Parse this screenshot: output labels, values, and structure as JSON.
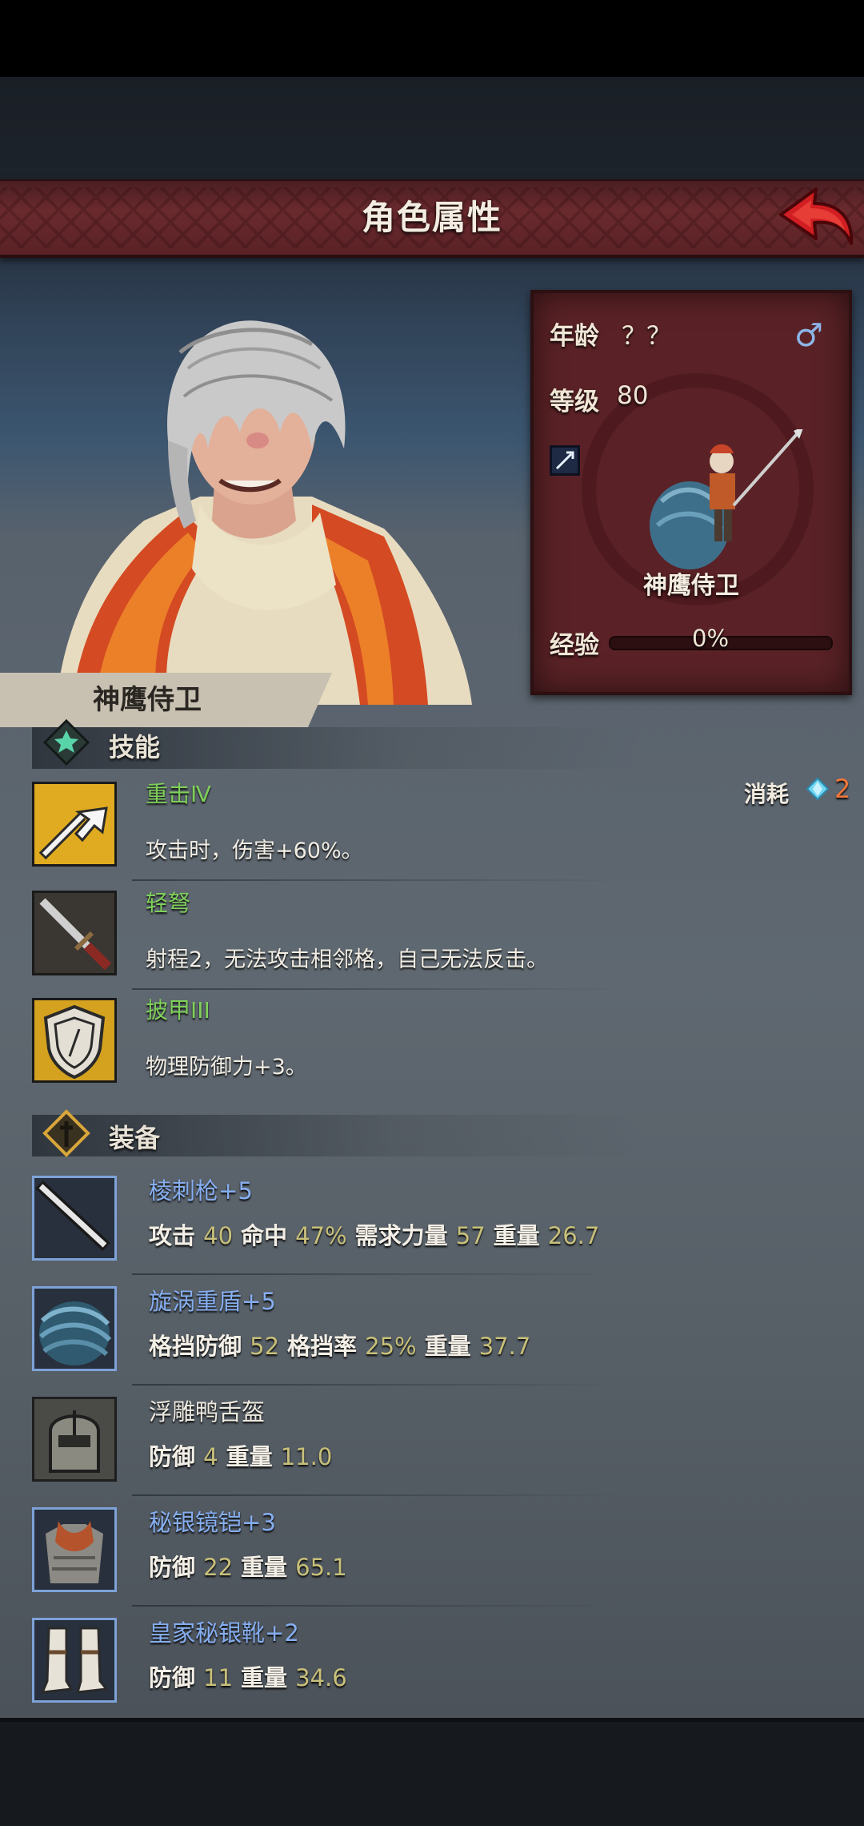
{
  "header": {
    "title": "角色属性"
  },
  "info_panel": {
    "age_label": "年龄",
    "age_value": "？？",
    "gender": "♂",
    "level_label": "等级",
    "level_value": "80",
    "unit_name": "神鹰侍卫",
    "exp_label": "经验",
    "exp_value": "0%",
    "exp_fraction": 0
  },
  "character_name": "神鹰侍卫",
  "skills": {
    "title": "技能",
    "cost_label": "消耗",
    "cost_value": "2",
    "items": [
      {
        "name": "重击Ⅳ",
        "desc": "攻击时，伤害+60%。"
      },
      {
        "name": "轻弩",
        "desc": "射程2，无法攻击相邻格，自己无法反击。"
      },
      {
        "name": "披甲III",
        "desc": "物理防御力+3。"
      }
    ]
  },
  "equipment": {
    "title": "装备",
    "items": [
      {
        "name": "棱刺枪",
        "plus": "+5",
        "stats": [
          {
            "label": "攻击",
            "value": "40"
          },
          {
            "label": "命中",
            "value": "47%"
          },
          {
            "label": "需求力量",
            "value": "57"
          },
          {
            "label": "重量",
            "value": "26.7"
          }
        ]
      },
      {
        "name": "旋涡重盾",
        "plus": "+5",
        "stats": [
          {
            "label": "格挡防御",
            "value": "52"
          },
          {
            "label": "格挡率",
            "value": "25%"
          },
          {
            "label": "重量",
            "value": "37.7"
          }
        ]
      },
      {
        "name": "浮雕鸭舌盔",
        "plus": "",
        "stats": [
          {
            "label": "防御",
            "value": "4"
          },
          {
            "label": "重量",
            "value": "11.0"
          }
        ]
      },
      {
        "name": "秘银镜铠",
        "plus": "+3",
        "stats": [
          {
            "label": "防御",
            "value": "22"
          },
          {
            "label": "重量",
            "value": "65.1"
          }
        ]
      },
      {
        "name": "皇家秘银靴",
        "plus": "+2",
        "stats": [
          {
            "label": "防御",
            "value": "11"
          },
          {
            "label": "重量",
            "value": "34.6"
          }
        ]
      }
    ]
  },
  "colors": {
    "skill_name": "#7fd05a",
    "equip_name": "#86aef0",
    "stat_value": "#c8c07a",
    "cost_value": "#f0763a",
    "header_bg": "#6a2a2e"
  }
}
